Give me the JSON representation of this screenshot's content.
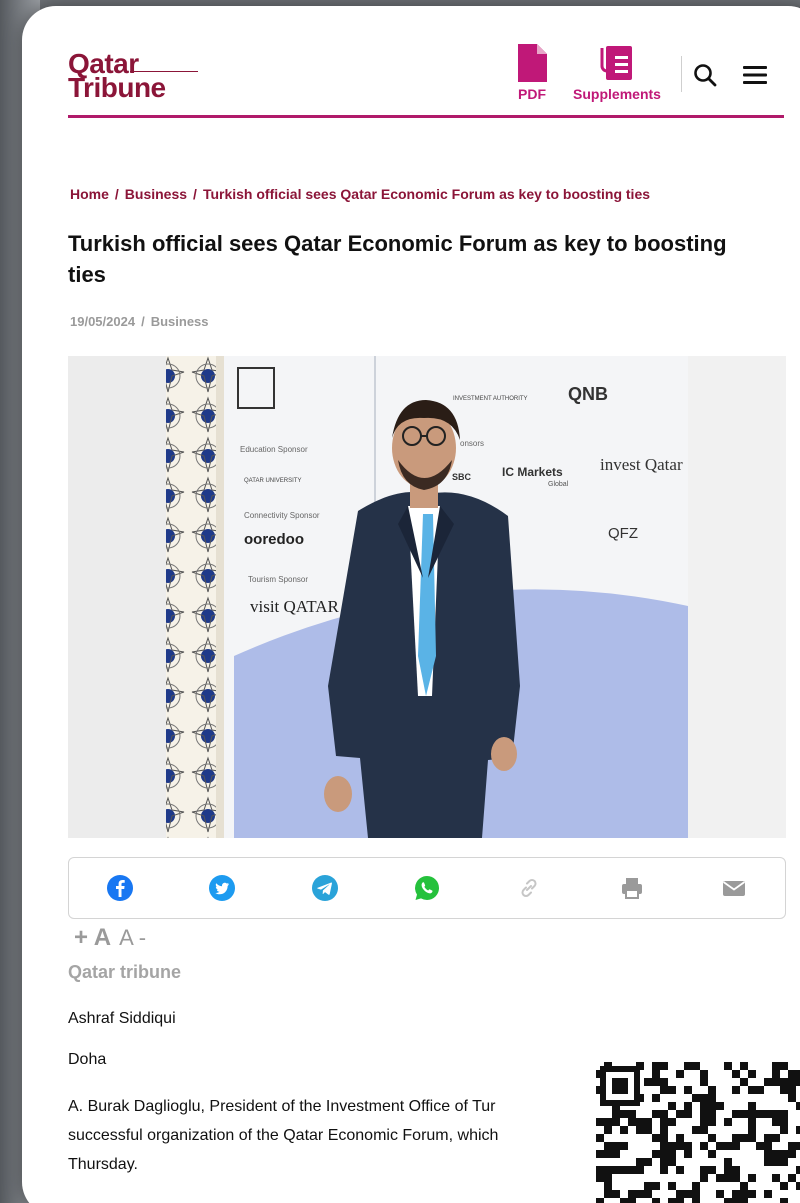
{
  "header": {
    "logo_line1": "Qatar",
    "logo_line2": "Tribune",
    "pdf_label": "PDF",
    "supplements_label": "Supplements",
    "search_icon": "search-icon",
    "menu_icon": "hamburger-menu-icon"
  },
  "breadcrumb": {
    "home": "Home",
    "separator": "/",
    "section": "Business",
    "current": "Turkish official sees Qatar Economic Forum as key to boosting ties"
  },
  "article": {
    "title": "Turkish official sees Qatar Economic Forum as key to boosting ties",
    "date": "19/05/2024",
    "meta_separator": "/",
    "category": "Business",
    "font_increase": "+ A",
    "font_decrease": "A -",
    "source": "Qatar tribune",
    "author": "Ashraf Siddiqui",
    "location": "Doha",
    "body_lines": [
      "A. Burak Daglioglu, President of the Investment Office of Tur",
      "successful organization of the Qatar Economic Forum, which",
      "Thursday."
    ]
  },
  "share": {
    "buttons": [
      {
        "name": "facebook",
        "icon": "facebook-icon",
        "color": "#1877f2"
      },
      {
        "name": "twitter",
        "icon": "twitter-icon",
        "color": "#1d9bf0"
      },
      {
        "name": "telegram",
        "icon": "telegram-icon",
        "color": "#2aa3d9"
      },
      {
        "name": "whatsapp",
        "icon": "whatsapp-icon",
        "color": "#25c13c"
      },
      {
        "name": "copy-link",
        "icon": "link-icon",
        "color": "#c6c6c6"
      },
      {
        "name": "print",
        "icon": "printer-icon",
        "color": "#9a9a9a"
      },
      {
        "name": "email",
        "icon": "mail-icon",
        "color": "#9a9a9a"
      }
    ]
  },
  "photo": {
    "sponsor_labels": [
      "Education Sponsor",
      "Connectivity Sponsor",
      "Tourism Sponsor",
      "onsors"
    ],
    "sponsor_logos": [
      "QNB",
      "ooredoo",
      "visit QATAR",
      "invest Qatar",
      "IC Markets",
      "QFZ",
      "SBC"
    ],
    "logo_subtexts": [
      "QATAR UNIVERSITY",
      "Global",
      "INVESTMENT AUTHORITY"
    ]
  },
  "colors": {
    "brand": "#8b1538",
    "accent": "#c01878",
    "muted": "#9a9a9a"
  }
}
